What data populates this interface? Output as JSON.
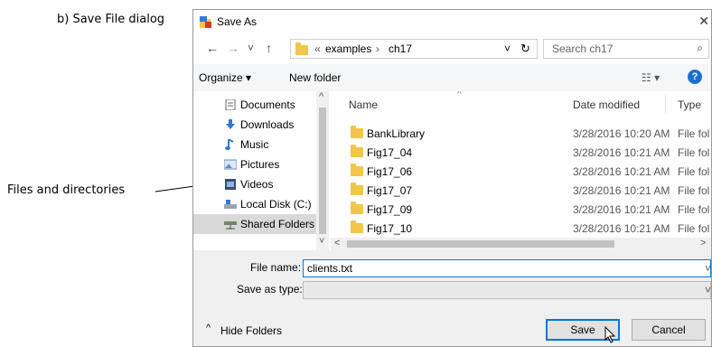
{
  "caption": "b) Save File dialog",
  "annotation": "Files and directories",
  "dialog": {
    "title": "Save As",
    "close_glyph": "✕",
    "nav": {
      "back_glyph": "←",
      "forward_glyph": "→",
      "recent_glyph": "˅",
      "up_glyph": "↑",
      "path_prefix": "«",
      "path_segments": [
        "examples",
        "ch17"
      ],
      "path_sep": "›",
      "refresh_glyph": "↻",
      "dropdown_glyph": "˅",
      "search_placeholder": "Search ch17",
      "search_glyph": "⌕"
    },
    "toolbar": {
      "organize": "Organize ▾",
      "new_folder": "New folder",
      "view_glyph": "☷ ▾",
      "help_glyph": "?"
    },
    "nav_pane": [
      {
        "label": "Documents",
        "icon": "document-icon"
      },
      {
        "label": "Downloads",
        "icon": "download-arrow-icon"
      },
      {
        "label": "Music",
        "icon": "music-note-icon"
      },
      {
        "label": "Pictures",
        "icon": "picture-icon"
      },
      {
        "label": "Videos",
        "icon": "video-icon"
      },
      {
        "label": "Local Disk (C:)",
        "icon": "drive-icon"
      },
      {
        "label": "Shared Folders (\\",
        "icon": "network-drive-icon"
      }
    ],
    "columns": {
      "name": "Name",
      "date": "Date modified",
      "type": "Type",
      "sort_glyph": "^"
    },
    "files": [
      {
        "name": "BankLibrary",
        "date": "3/28/2016 10:20 AM",
        "type": "File fol"
      },
      {
        "name": "Fig17_04",
        "date": "3/28/2016 10:21 AM",
        "type": "File fol"
      },
      {
        "name": "Fig17_06",
        "date": "3/28/2016 10:21 AM",
        "type": "File fol"
      },
      {
        "name": "Fig17_07",
        "date": "3/28/2016 10:21 AM",
        "type": "File fol"
      },
      {
        "name": "Fig17_09",
        "date": "3/28/2016 10:21 AM",
        "type": "File fol"
      },
      {
        "name": "Fig17_10",
        "date": "3/28/2016 10:21 AM",
        "type": "File fol"
      }
    ],
    "scroll": {
      "up": "^",
      "down": "˅",
      "left": "<",
      "right": ">"
    },
    "form": {
      "file_name_label": "File name:",
      "file_name_value": "clients.txt",
      "save_type_label": "Save as type:",
      "save_type_value": "",
      "hide_folders": "Hide Folders",
      "hide_glyph": "^",
      "save_button": "Save",
      "cancel_button": "Cancel",
      "dropdown_glyph": "˅"
    }
  },
  "colors": {
    "folder": "#f2c64b",
    "accent": "#0078d7",
    "help": "#1e6fd0",
    "selection": "#cce8ff"
  }
}
